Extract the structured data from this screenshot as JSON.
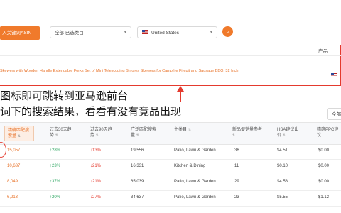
{
  "toolbar": {
    "asin_button": "入关键词ASIN",
    "category_select": "全部 已选类目",
    "country_select": "United States",
    "search_icon": "search-icon"
  },
  "product_header": {
    "label": "产品"
  },
  "product": {
    "title": "Skewers with Wooden Handle Extendable Forks Set of Mini Telescoping Smores Skewers for Campfire Firepit and Sausage BBQ, 32 Inch"
  },
  "annotation": {
    "line1": "图标即可跳转到亚马逊前台",
    "line2": "词下的搜索结果，看看有没有竞品出现"
  },
  "filter": {
    "all_label": "全部"
  },
  "table": {
    "headers": [
      "精确匹配搜索量",
      "过去30天趋势",
      "过去90天趋势",
      "广泛匹配搜索量",
      "主类目",
      "新品促销量参考",
      "HSA建议出价",
      "精确PPC建议"
    ],
    "rows": [
      {
        "kw": "15,057",
        "t30": "28%",
        "t30dir": "up",
        "t90": "13%",
        "t90dir": "down",
        "broad": "19,556",
        "cat": "Patio, Lawn & Garden",
        "promo": "36",
        "hsa": "$4.51",
        "ppc": "$0.00"
      },
      {
        "kw": "10,637",
        "t30": "23%",
        "t30dir": "up",
        "t90": "21%",
        "t90dir": "down",
        "broad": "16,331",
        "cat": "Kitchen & Dining",
        "promo": "11",
        "hsa": "$0.10",
        "ppc": "$0.00"
      },
      {
        "kw": "8,049",
        "t30": "37%",
        "t30dir": "up",
        "t90": "21%",
        "t90dir": "down",
        "broad": "65,039",
        "cat": "Patio, Lawn & Garden",
        "promo": "29",
        "hsa": "$4.58",
        "ppc": "$0.00"
      },
      {
        "kw": "6,213",
        "t30": "20%",
        "t30dir": "up",
        "t90": "27%",
        "t90dir": "down",
        "broad": "34,637",
        "cat": "Patio, Lawn & Garden",
        "promo": "23",
        "hsa": "$5.55",
        "ppc": "$1.12"
      }
    ]
  },
  "colors": {
    "accent": "#f07a2b",
    "highlight_red": "#e43a2e",
    "up_green": "#2aa55f"
  }
}
